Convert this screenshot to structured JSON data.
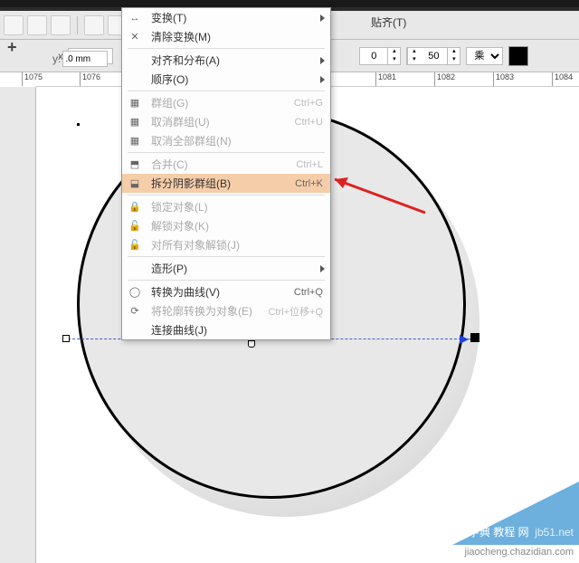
{
  "toolbar": {
    "snap_label": "贴齐(T)",
    "coord_x_label": "x:",
    "coord_y_label": "y:",
    "coord_x": ".0 mm",
    "coord_y": ".0 mm",
    "spin_a": "0",
    "spin_b": "50",
    "select_val": "乘"
  },
  "ruler": [
    "1075",
    "1076",
    "1081",
    "1082",
    "1083",
    "1084"
  ],
  "menu": [
    {
      "icon": "↔",
      "label": "变换(T)",
      "hotkey": "",
      "sub": true,
      "disabled": false
    },
    {
      "icon": "✕",
      "label": "清除变换(M)",
      "hotkey": "",
      "sub": false,
      "disabled": false
    },
    {
      "sep": true
    },
    {
      "icon": "",
      "label": "对齐和分布(A)",
      "hotkey": "",
      "sub": true,
      "disabled": false
    },
    {
      "icon": "",
      "label": "顺序(O)",
      "hotkey": "",
      "sub": true,
      "disabled": false
    },
    {
      "sep": true
    },
    {
      "icon": "▦",
      "label": "群组(G)",
      "hotkey": "Ctrl+G",
      "sub": false,
      "disabled": true
    },
    {
      "icon": "▦",
      "label": "取消群组(U)",
      "hotkey": "Ctrl+U",
      "sub": false,
      "disabled": true
    },
    {
      "icon": "▦",
      "label": "取消全部群组(N)",
      "hotkey": "",
      "sub": false,
      "disabled": true
    },
    {
      "sep": true
    },
    {
      "icon": "⬒",
      "label": "合并(C)",
      "hotkey": "Ctrl+L",
      "sub": false,
      "disabled": true
    },
    {
      "icon": "⬓",
      "label": "拆分阴影群组(B)",
      "hotkey": "Ctrl+K",
      "sub": false,
      "disabled": false,
      "hover": true
    },
    {
      "sep": true
    },
    {
      "icon": "🔒",
      "label": "锁定对象(L)",
      "hotkey": "",
      "sub": false,
      "disabled": true
    },
    {
      "icon": "🔓",
      "label": "解锁对象(K)",
      "hotkey": "",
      "sub": false,
      "disabled": true
    },
    {
      "icon": "🔓",
      "label": "对所有对象解锁(J)",
      "hotkey": "",
      "sub": false,
      "disabled": true
    },
    {
      "sep": true
    },
    {
      "icon": "",
      "label": "造形(P)",
      "hotkey": "",
      "sub": true,
      "disabled": false
    },
    {
      "sep": true
    },
    {
      "icon": "◯",
      "label": "转换为曲线(V)",
      "hotkey": "Ctrl+Q",
      "sub": false,
      "disabled": false
    },
    {
      "icon": "⟳",
      "label": "将轮廓转换为对象(E)",
      "hotkey": "Ctrl+位移+Q",
      "sub": false,
      "disabled": true
    },
    {
      "icon": "",
      "label": "连接曲线(J)",
      "hotkey": "",
      "sub": false,
      "disabled": false
    }
  ],
  "watermark": {
    "text": "查字典 教程 网",
    "url": "jiaocheng.chazidian.com",
    "badge": "jb51.net"
  }
}
